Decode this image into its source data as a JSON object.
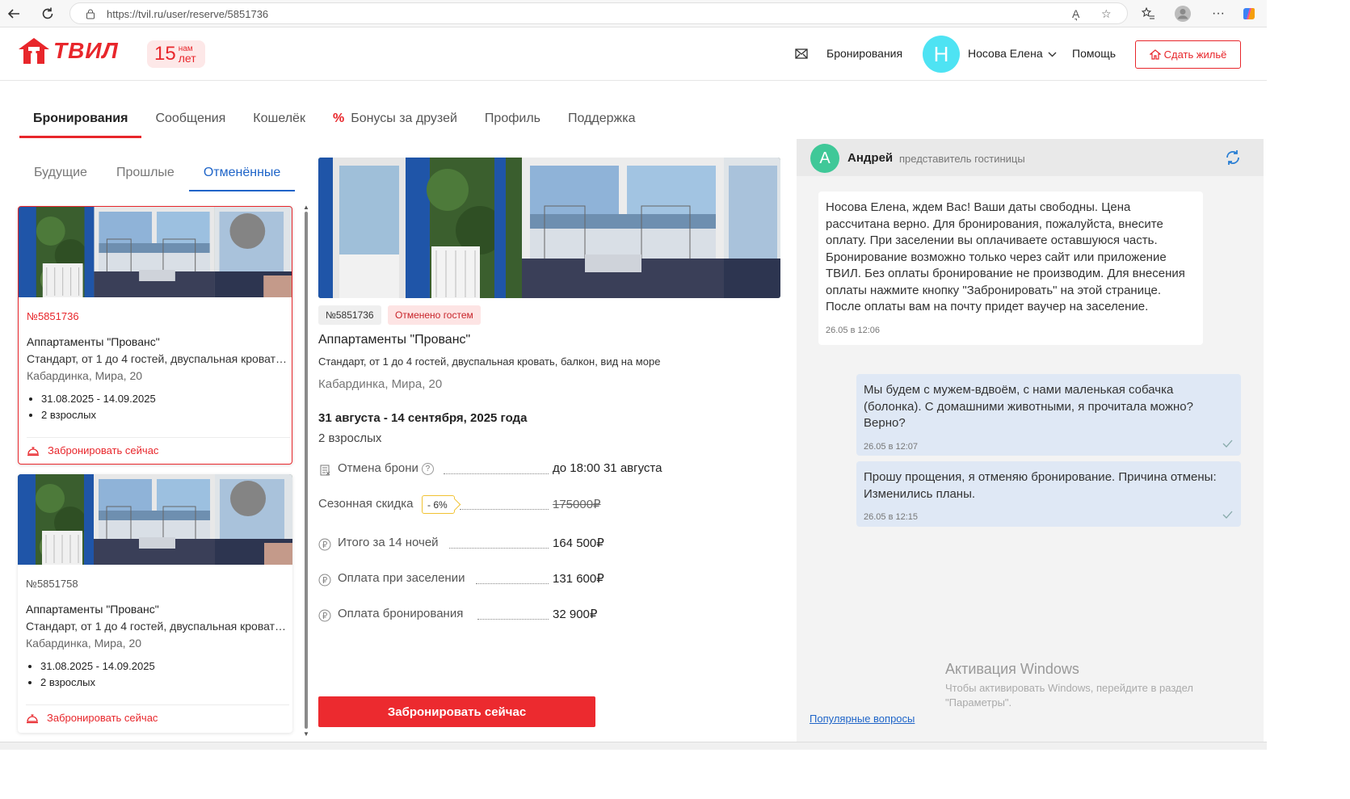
{
  "browser": {
    "url": "https://tvil.ru/user/reserve/5851736",
    "reader_label": "A͉"
  },
  "header": {
    "logo_text": "ТВИЛ",
    "badge_number": "15",
    "badge_small_top": "нам",
    "badge_small_bottom": "лет",
    "bookings_link": "Бронирования",
    "avatar_letter": "Н",
    "user_name": "Носова Елена",
    "help_link": "Помощь",
    "rent_button": "Сдать жильё",
    "colors": {
      "brand": "#e8262b",
      "avatar": "#4ee3f3"
    }
  },
  "main_tabs": [
    {
      "label": "Бронирования",
      "active": true
    },
    {
      "label": "Сообщения",
      "active": false
    },
    {
      "label": "Кошелёк",
      "active": false
    },
    {
      "label": "Бонусы за друзей",
      "active": false,
      "icon": "percent-icon"
    },
    {
      "label": "Профиль",
      "active": false
    },
    {
      "label": "Поддержка",
      "active": false
    }
  ],
  "sub_tabs": [
    {
      "label": "Будущие",
      "active": false
    },
    {
      "label": "Прошлые",
      "active": false
    },
    {
      "label": "Отменённые",
      "active": true
    }
  ],
  "reservations": [
    {
      "number": "№5851736",
      "title": "Аппартаменты \"Прованс\"",
      "description": "Стандарт, от 1 до 4 гостей, двуспальная кровать, балкон, вид на море",
      "address": "Кабардинка, Мира, 20",
      "dates": "31.08.2025 - 14.09.2025",
      "guests": "2 взрослых",
      "book_label": "Забронировать сейчас",
      "selected": true
    },
    {
      "number": "№5851758",
      "title": "Аппартаменты \"Прованс\"",
      "description": "Стандарт, от 1 до 4 гостей, двуспальная кровать, балкон, вид на море",
      "address": "Кабардинка, Мира, 20",
      "dates": "31.08.2025 - 14.09.2025",
      "guests": "2 взрослых",
      "book_label": "Забронировать сейчас",
      "selected": false
    }
  ],
  "detail": {
    "number": "№5851736",
    "status": "Отменено гостем",
    "title": "Аппартаменты \"Прованс\"",
    "description": "Стандарт, от 1 до 4 гостей, двуспальная кровать, балкон, вид на море",
    "address": "Кабардинка, Мира, 20",
    "dates": "31 августа - 14 сентября, 2025 года",
    "guests": "2 взрослых",
    "cancel_label": "Отмена брони",
    "cancel_value": "до 18:00 31 августа",
    "discount_label": "Сезонная скидка",
    "discount_badge": "- 6%",
    "discount_value": "175000₽",
    "total_label": "Итого за 14 ночей",
    "total_value": "164 500₽",
    "checkin_label": "Оплата при заселении",
    "checkin_value": "131 600₽",
    "booking_label": "Оплата бронирования",
    "booking_value": "32 900₽",
    "book_button": "Забронировать сейчас"
  },
  "chat": {
    "avatar_letter": "А",
    "name": "Андрей",
    "role": "представитель гостиницы",
    "messages": [
      {
        "text": "Носова Елена, ждем Вас! Ваши даты свободны. Цена рассчитана верно. Для бронирования, пожалуйста, внесите оплату. При заселении вы оплачиваете оставшуюся часть. Бронирование возможно только через сайт или приложение ТВИЛ. Без оплаты бронирование не производим. Для внесения оплаты нажмите кнопку \"Забронировать\" на этой странице. После оплаты вам на почту придет ваучер на заселение.",
        "time": "26.05 в 12:06"
      },
      {
        "text": "Мы будем с мужем-вдвоём, с нами маленькая собачка (болонка). С домашними животными, я прочитала можно? Верно?",
        "time": "26.05 в 12:07"
      },
      {
        "text": "Прошу прощения, я отменяю бронирование. Причина отмены: Изменились планы.",
        "time": "26.05 в 12:15"
      }
    ],
    "windows_title": "Активация Windows",
    "windows_text": "Чтобы активировать Windows, перейдите в раздел \"Параметры\".",
    "faq_link": "Популярные вопросы"
  }
}
